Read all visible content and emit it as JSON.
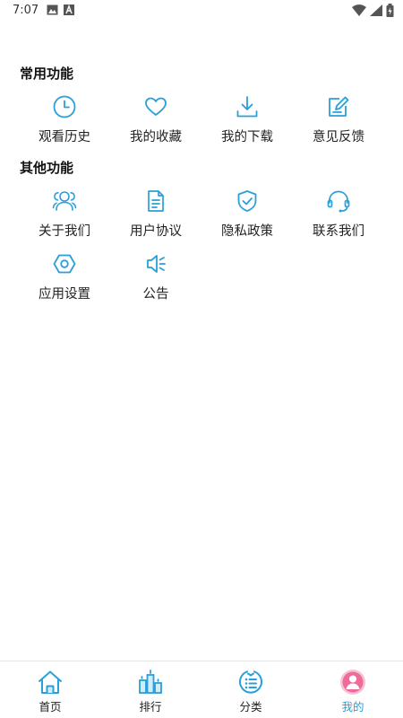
{
  "status_bar": {
    "time": "7:07",
    "icons_left": [
      "image-icon",
      "text-a-icon"
    ],
    "icons_right": [
      "wifi-icon",
      "signal-icon",
      "battery-icon"
    ]
  },
  "colors": {
    "accent": "#2a9fd8",
    "avatar": "#ee6c99",
    "text": "#222222"
  },
  "sections": [
    {
      "title": "常用功能",
      "items": [
        {
          "label": "观看历史",
          "icon": "clock-icon"
        },
        {
          "label": "我的收藏",
          "icon": "heart-icon"
        },
        {
          "label": "我的下载",
          "icon": "download-icon"
        },
        {
          "label": "意见反馈",
          "icon": "feedback-edit-icon"
        }
      ]
    },
    {
      "title": "其他功能",
      "items": [
        {
          "label": "关于我们",
          "icon": "users-icon"
        },
        {
          "label": "用户协议",
          "icon": "document-icon"
        },
        {
          "label": "隐私政策",
          "icon": "shield-check-icon"
        },
        {
          "label": "联系我们",
          "icon": "headset-icon"
        },
        {
          "label": "应用设置",
          "icon": "hexagon-settings-icon"
        },
        {
          "label": "公告",
          "icon": "speaker-icon"
        }
      ]
    }
  ],
  "bottom_nav": [
    {
      "label": "首页",
      "icon": "home-icon",
      "active": false
    },
    {
      "label": "排行",
      "icon": "ranking-icon",
      "active": false
    },
    {
      "label": "分类",
      "icon": "category-list-icon",
      "active": false
    },
    {
      "label": "我的",
      "icon": "avatar-icon",
      "active": true
    }
  ]
}
